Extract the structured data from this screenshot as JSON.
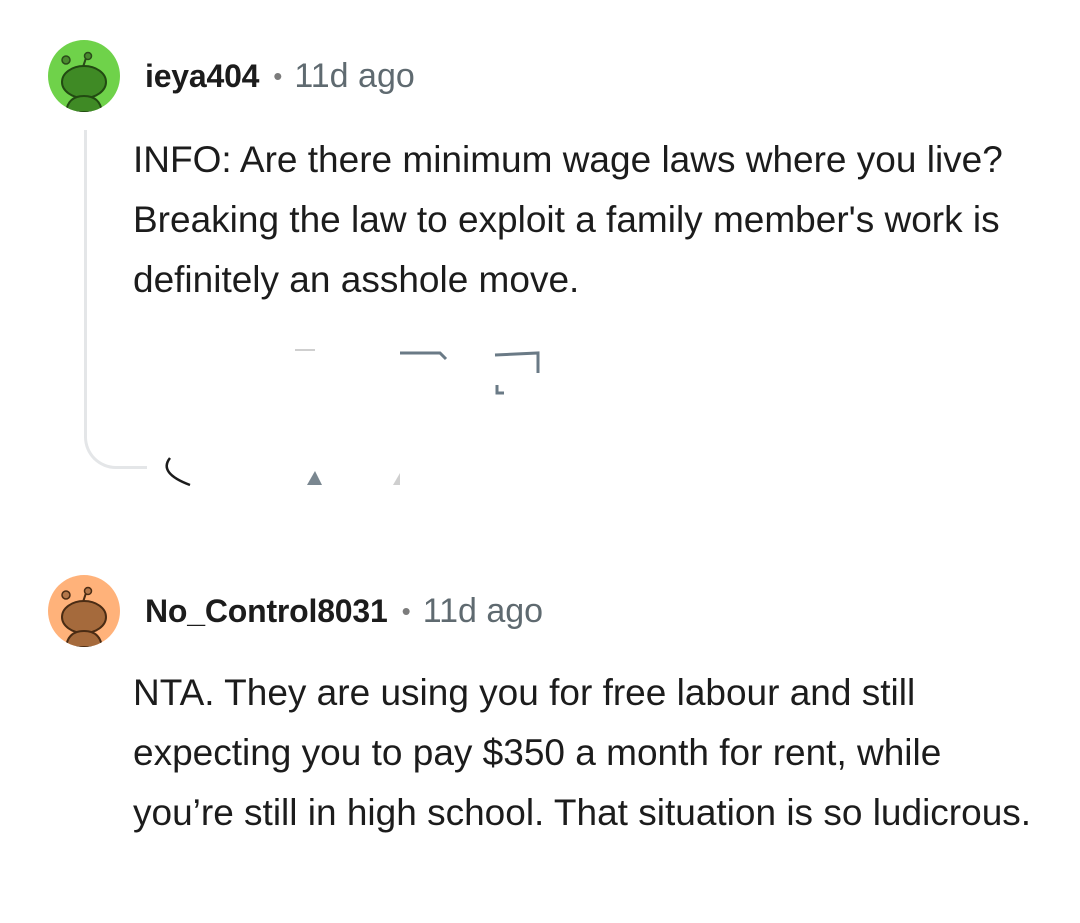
{
  "comments": [
    {
      "username": "ieya404",
      "separator": "•",
      "age": "11d ago",
      "avatar_icon": "snoo-avatar-icon",
      "avatar_color": "#6fd24a",
      "text": "INFO: Are there minimum wage laws where you live? Breaking the law to exploit a family member's work is definitely an asshole move."
    },
    {
      "username": "No_Control8031",
      "separator": "•",
      "age": "11d ago",
      "avatar_icon": "snoo-avatar-icon",
      "avatar_color": "#ffb27a",
      "text": "NTA. They are using you for free labour and still expecting you to pay $350 a month for rent, while you’re still in high school. That situation is so ludicrous."
    }
  ],
  "colors": {
    "text": "#1c1c1c",
    "meta": "#5f6a70",
    "thread_line": "#e4e6e8"
  }
}
